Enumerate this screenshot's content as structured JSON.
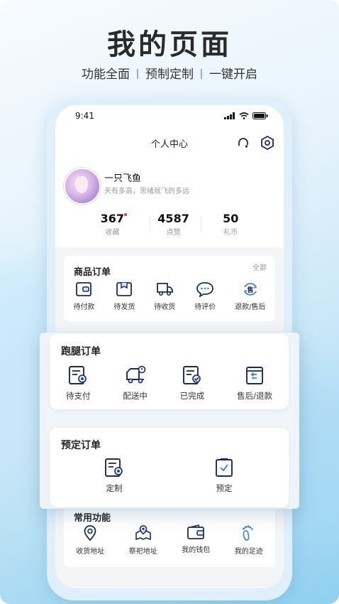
{
  "hero": {
    "title": "我的页面",
    "features": [
      "功能全面",
      "预制定制",
      "一键开启"
    ]
  },
  "status_bar": {
    "time": "9:41"
  },
  "nav": {
    "title": "个人中心"
  },
  "profile": {
    "name": "一只飞鱼",
    "bio": "天有多高，思绪就飞的多远"
  },
  "stats": [
    {
      "value": "367",
      "label": "收藏"
    },
    {
      "value": "4587",
      "label": "点赞"
    },
    {
      "value": "50",
      "label": "礼币"
    }
  ],
  "goods_orders": {
    "title": "商品订单",
    "view_all": "全部",
    "items": [
      {
        "label": "待付款",
        "icon": "wallet-icon"
      },
      {
        "label": "待发货",
        "icon": "package-icon"
      },
      {
        "label": "待收货",
        "icon": "truck-icon"
      },
      {
        "label": "待评价",
        "icon": "comment-icon"
      },
      {
        "label": "退款/售后",
        "icon": "refund-icon",
        "badge": "售"
      }
    ]
  },
  "errand_orders": {
    "title": "跑腿订单",
    "items": [
      {
        "label": "待支付",
        "icon": "payment-doc-icon"
      },
      {
        "label": "配送中",
        "icon": "delivery-icon"
      },
      {
        "label": "已完成",
        "icon": "completed-doc-icon"
      },
      {
        "label": "售后/退款",
        "icon": "return-icon"
      }
    ]
  },
  "reserve_orders": {
    "title": "预定订单",
    "items": [
      {
        "label": "定制",
        "icon": "custom-doc-icon"
      },
      {
        "label": "预定",
        "icon": "checklist-icon"
      }
    ]
  },
  "common": {
    "title": "常用功能",
    "items": [
      {
        "label": "收货地址",
        "icon": "location-pin-icon"
      },
      {
        "label": "祭祀地址",
        "icon": "map-marker-icon"
      },
      {
        "label": "我的钱包",
        "icon": "wallet-icon"
      },
      {
        "label": "我的足迹",
        "icon": "footprint-icon"
      }
    ]
  },
  "colors": {
    "accent": "#1a2a5e",
    "badge_blue": "#3b82d6",
    "bg_gradient_end": "#8fd0f0"
  }
}
